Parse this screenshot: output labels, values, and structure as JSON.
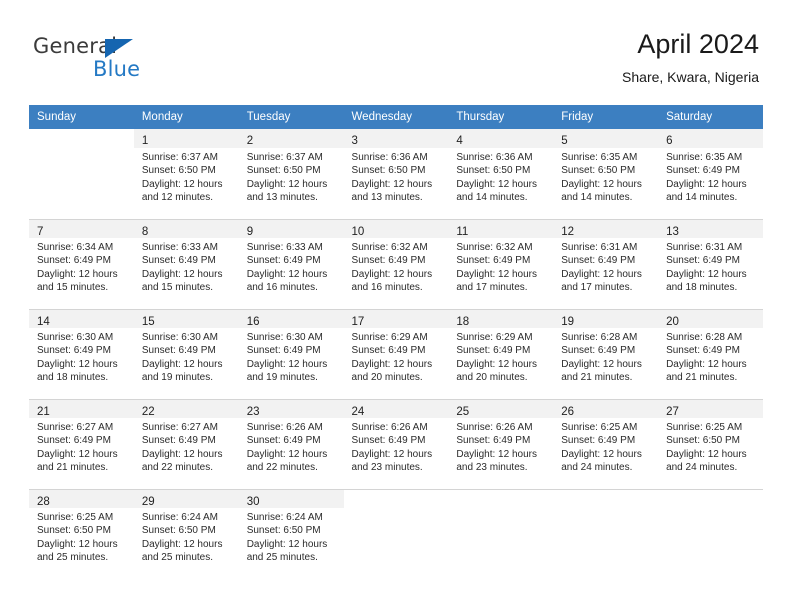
{
  "brand": {
    "name_top": "General",
    "name_bottom": "Blue",
    "triangle_color": "#1565b0",
    "blue_color": "#2479c4"
  },
  "header": {
    "title": "April 2024",
    "subtitle": "Share, Kwara, Nigeria"
  },
  "theme": {
    "header_row_bg": "#3c7fc1",
    "header_row_text": "#ffffff",
    "daynum_bar_bg": "#f2f2f2",
    "grid_line": "#d4d4d4"
  },
  "weekday_headers": [
    "Sunday",
    "Monday",
    "Tuesday",
    "Wednesday",
    "Thursday",
    "Friday",
    "Saturday"
  ],
  "labels": {
    "sunrise_prefix": "Sunrise:",
    "sunset_prefix": "Sunset:",
    "daylight_prefix": "Daylight:"
  },
  "weeks": [
    [
      {
        "day": "",
        "blank": true
      },
      {
        "day": "1",
        "sunrise": "Sunrise: 6:37 AM",
        "sunset": "Sunset: 6:50 PM",
        "daylight_1": "Daylight: 12 hours",
        "daylight_2": "and 12 minutes."
      },
      {
        "day": "2",
        "sunrise": "Sunrise: 6:37 AM",
        "sunset": "Sunset: 6:50 PM",
        "daylight_1": "Daylight: 12 hours",
        "daylight_2": "and 13 minutes."
      },
      {
        "day": "3",
        "sunrise": "Sunrise: 6:36 AM",
        "sunset": "Sunset: 6:50 PM",
        "daylight_1": "Daylight: 12 hours",
        "daylight_2": "and 13 minutes."
      },
      {
        "day": "4",
        "sunrise": "Sunrise: 6:36 AM",
        "sunset": "Sunset: 6:50 PM",
        "daylight_1": "Daylight: 12 hours",
        "daylight_2": "and 14 minutes."
      },
      {
        "day": "5",
        "sunrise": "Sunrise: 6:35 AM",
        "sunset": "Sunset: 6:50 PM",
        "daylight_1": "Daylight: 12 hours",
        "daylight_2": "and 14 minutes."
      },
      {
        "day": "6",
        "sunrise": "Sunrise: 6:35 AM",
        "sunset": "Sunset: 6:49 PM",
        "daylight_1": "Daylight: 12 hours",
        "daylight_2": "and 14 minutes."
      }
    ],
    [
      {
        "day": "7",
        "sunrise": "Sunrise: 6:34 AM",
        "sunset": "Sunset: 6:49 PM",
        "daylight_1": "Daylight: 12 hours",
        "daylight_2": "and 15 minutes."
      },
      {
        "day": "8",
        "sunrise": "Sunrise: 6:33 AM",
        "sunset": "Sunset: 6:49 PM",
        "daylight_1": "Daylight: 12 hours",
        "daylight_2": "and 15 minutes."
      },
      {
        "day": "9",
        "sunrise": "Sunrise: 6:33 AM",
        "sunset": "Sunset: 6:49 PM",
        "daylight_1": "Daylight: 12 hours",
        "daylight_2": "and 16 minutes."
      },
      {
        "day": "10",
        "sunrise": "Sunrise: 6:32 AM",
        "sunset": "Sunset: 6:49 PM",
        "daylight_1": "Daylight: 12 hours",
        "daylight_2": "and 16 minutes."
      },
      {
        "day": "11",
        "sunrise": "Sunrise: 6:32 AM",
        "sunset": "Sunset: 6:49 PM",
        "daylight_1": "Daylight: 12 hours",
        "daylight_2": "and 17 minutes."
      },
      {
        "day": "12",
        "sunrise": "Sunrise: 6:31 AM",
        "sunset": "Sunset: 6:49 PM",
        "daylight_1": "Daylight: 12 hours",
        "daylight_2": "and 17 minutes."
      },
      {
        "day": "13",
        "sunrise": "Sunrise: 6:31 AM",
        "sunset": "Sunset: 6:49 PM",
        "daylight_1": "Daylight: 12 hours",
        "daylight_2": "and 18 minutes."
      }
    ],
    [
      {
        "day": "14",
        "sunrise": "Sunrise: 6:30 AM",
        "sunset": "Sunset: 6:49 PM",
        "daylight_1": "Daylight: 12 hours",
        "daylight_2": "and 18 minutes."
      },
      {
        "day": "15",
        "sunrise": "Sunrise: 6:30 AM",
        "sunset": "Sunset: 6:49 PM",
        "daylight_1": "Daylight: 12 hours",
        "daylight_2": "and 19 minutes."
      },
      {
        "day": "16",
        "sunrise": "Sunrise: 6:30 AM",
        "sunset": "Sunset: 6:49 PM",
        "daylight_1": "Daylight: 12 hours",
        "daylight_2": "and 19 minutes."
      },
      {
        "day": "17",
        "sunrise": "Sunrise: 6:29 AM",
        "sunset": "Sunset: 6:49 PM",
        "daylight_1": "Daylight: 12 hours",
        "daylight_2": "and 20 minutes."
      },
      {
        "day": "18",
        "sunrise": "Sunrise: 6:29 AM",
        "sunset": "Sunset: 6:49 PM",
        "daylight_1": "Daylight: 12 hours",
        "daylight_2": "and 20 minutes."
      },
      {
        "day": "19",
        "sunrise": "Sunrise: 6:28 AM",
        "sunset": "Sunset: 6:49 PM",
        "daylight_1": "Daylight: 12 hours",
        "daylight_2": "and 21 minutes."
      },
      {
        "day": "20",
        "sunrise": "Sunrise: 6:28 AM",
        "sunset": "Sunset: 6:49 PM",
        "daylight_1": "Daylight: 12 hours",
        "daylight_2": "and 21 minutes."
      }
    ],
    [
      {
        "day": "21",
        "sunrise": "Sunrise: 6:27 AM",
        "sunset": "Sunset: 6:49 PM",
        "daylight_1": "Daylight: 12 hours",
        "daylight_2": "and 21 minutes."
      },
      {
        "day": "22",
        "sunrise": "Sunrise: 6:27 AM",
        "sunset": "Sunset: 6:49 PM",
        "daylight_1": "Daylight: 12 hours",
        "daylight_2": "and 22 minutes."
      },
      {
        "day": "23",
        "sunrise": "Sunrise: 6:26 AM",
        "sunset": "Sunset: 6:49 PM",
        "daylight_1": "Daylight: 12 hours",
        "daylight_2": "and 22 minutes."
      },
      {
        "day": "24",
        "sunrise": "Sunrise: 6:26 AM",
        "sunset": "Sunset: 6:49 PM",
        "daylight_1": "Daylight: 12 hours",
        "daylight_2": "and 23 minutes."
      },
      {
        "day": "25",
        "sunrise": "Sunrise: 6:26 AM",
        "sunset": "Sunset: 6:49 PM",
        "daylight_1": "Daylight: 12 hours",
        "daylight_2": "and 23 minutes."
      },
      {
        "day": "26",
        "sunrise": "Sunrise: 6:25 AM",
        "sunset": "Sunset: 6:49 PM",
        "daylight_1": "Daylight: 12 hours",
        "daylight_2": "and 24 minutes."
      },
      {
        "day": "27",
        "sunrise": "Sunrise: 6:25 AM",
        "sunset": "Sunset: 6:50 PM",
        "daylight_1": "Daylight: 12 hours",
        "daylight_2": "and 24 minutes."
      }
    ],
    [
      {
        "day": "28",
        "sunrise": "Sunrise: 6:25 AM",
        "sunset": "Sunset: 6:50 PM",
        "daylight_1": "Daylight: 12 hours",
        "daylight_2": "and 25 minutes."
      },
      {
        "day": "29",
        "sunrise": "Sunrise: 6:24 AM",
        "sunset": "Sunset: 6:50 PM",
        "daylight_1": "Daylight: 12 hours",
        "daylight_2": "and 25 minutes."
      },
      {
        "day": "30",
        "sunrise": "Sunrise: 6:24 AM",
        "sunset": "Sunset: 6:50 PM",
        "daylight_1": "Daylight: 12 hours",
        "daylight_2": "and 25 minutes."
      },
      {
        "day": "",
        "blank": true
      },
      {
        "day": "",
        "blank": true
      },
      {
        "day": "",
        "blank": true
      },
      {
        "day": "",
        "blank": true
      }
    ]
  ]
}
